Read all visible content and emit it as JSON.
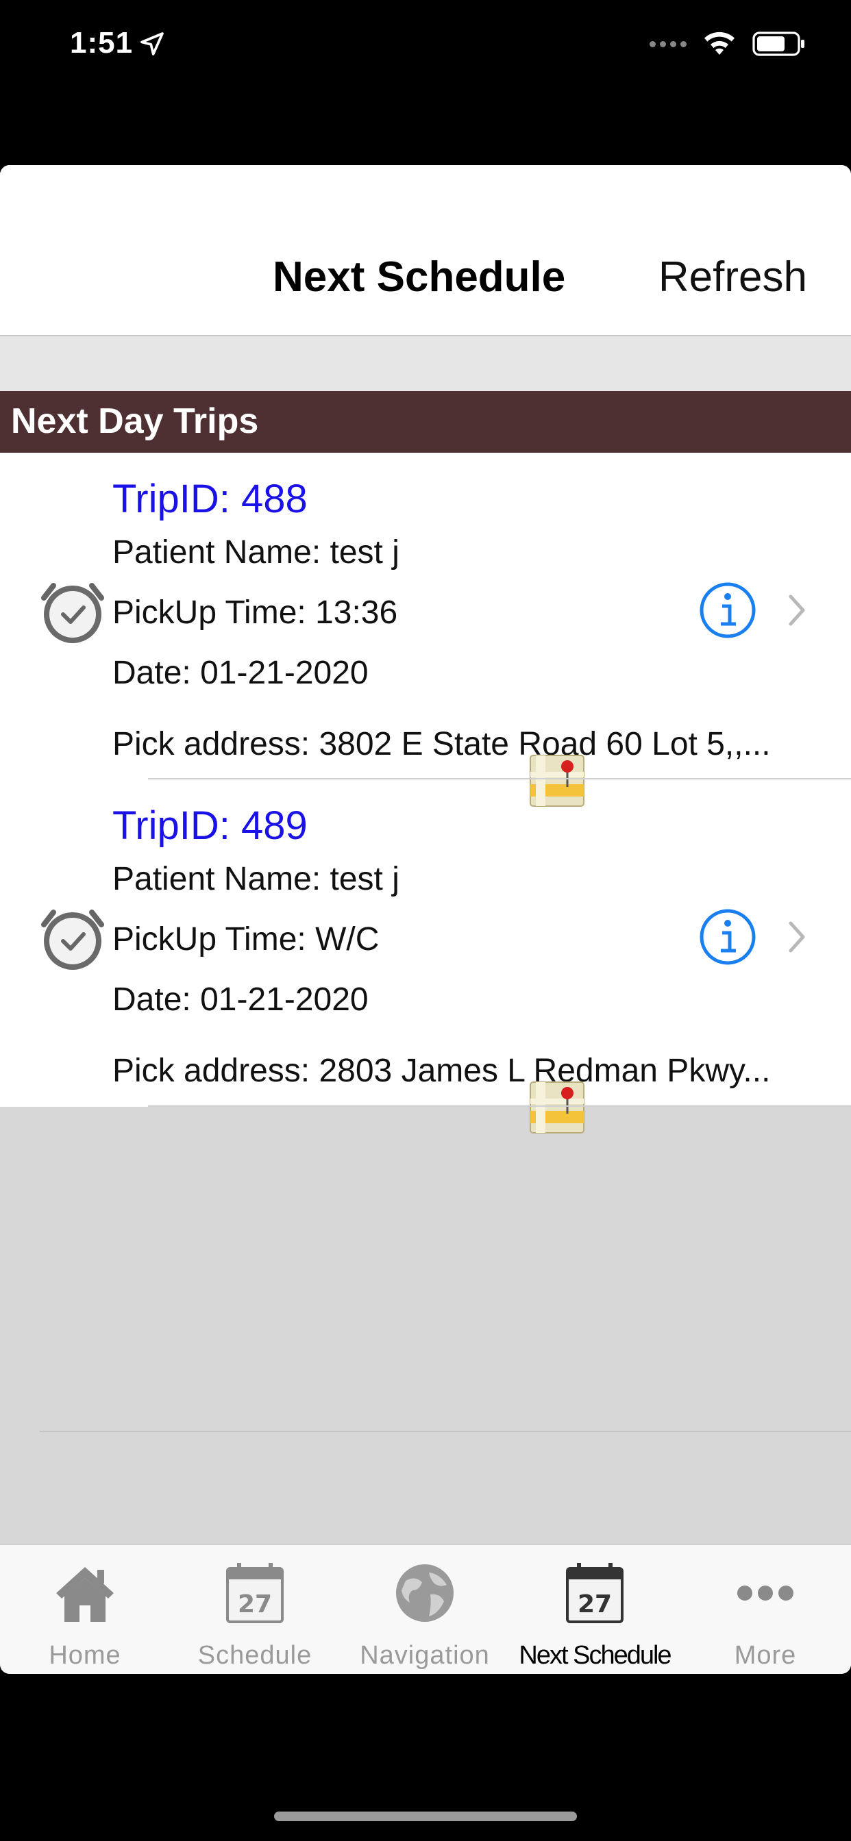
{
  "status_bar": {
    "time": "1:51"
  },
  "header": {
    "title": "Next Schedule",
    "refresh_label": "Refresh"
  },
  "section": {
    "title": "Next Day Trips"
  },
  "trips": [
    {
      "trip_id": "TripID: 488",
      "patient": "Patient Name: test j",
      "pickup_time": "PickUp Time: 13:36",
      "date": "Date: 01-21-2020",
      "address": "Pick address: 3802 E State Road 60 Lot 5,,..."
    },
    {
      "trip_id": "TripID: 489",
      "patient": "Patient Name: test j",
      "pickup_time": "PickUp Time: W/C",
      "date": "Date: 01-21-2020",
      "address": "Pick address: 2803 James L Redman Pkwy..."
    }
  ],
  "tabs": [
    {
      "label": "Home",
      "icon": "home-icon"
    },
    {
      "label": "Schedule",
      "icon": "calendar-icon",
      "day": "27"
    },
    {
      "label": "Navigation",
      "icon": "globe-icon"
    },
    {
      "label": "Next Schedule",
      "icon": "calendar-icon",
      "day": "27",
      "active": true
    },
    {
      "label": "More",
      "icon": "more-icon"
    }
  ],
  "colors": {
    "section_header_bg": "#4e3032",
    "trip_id": "#1a10e8",
    "info_icon": "#1a7ff0",
    "background": "#d7d7d7"
  }
}
